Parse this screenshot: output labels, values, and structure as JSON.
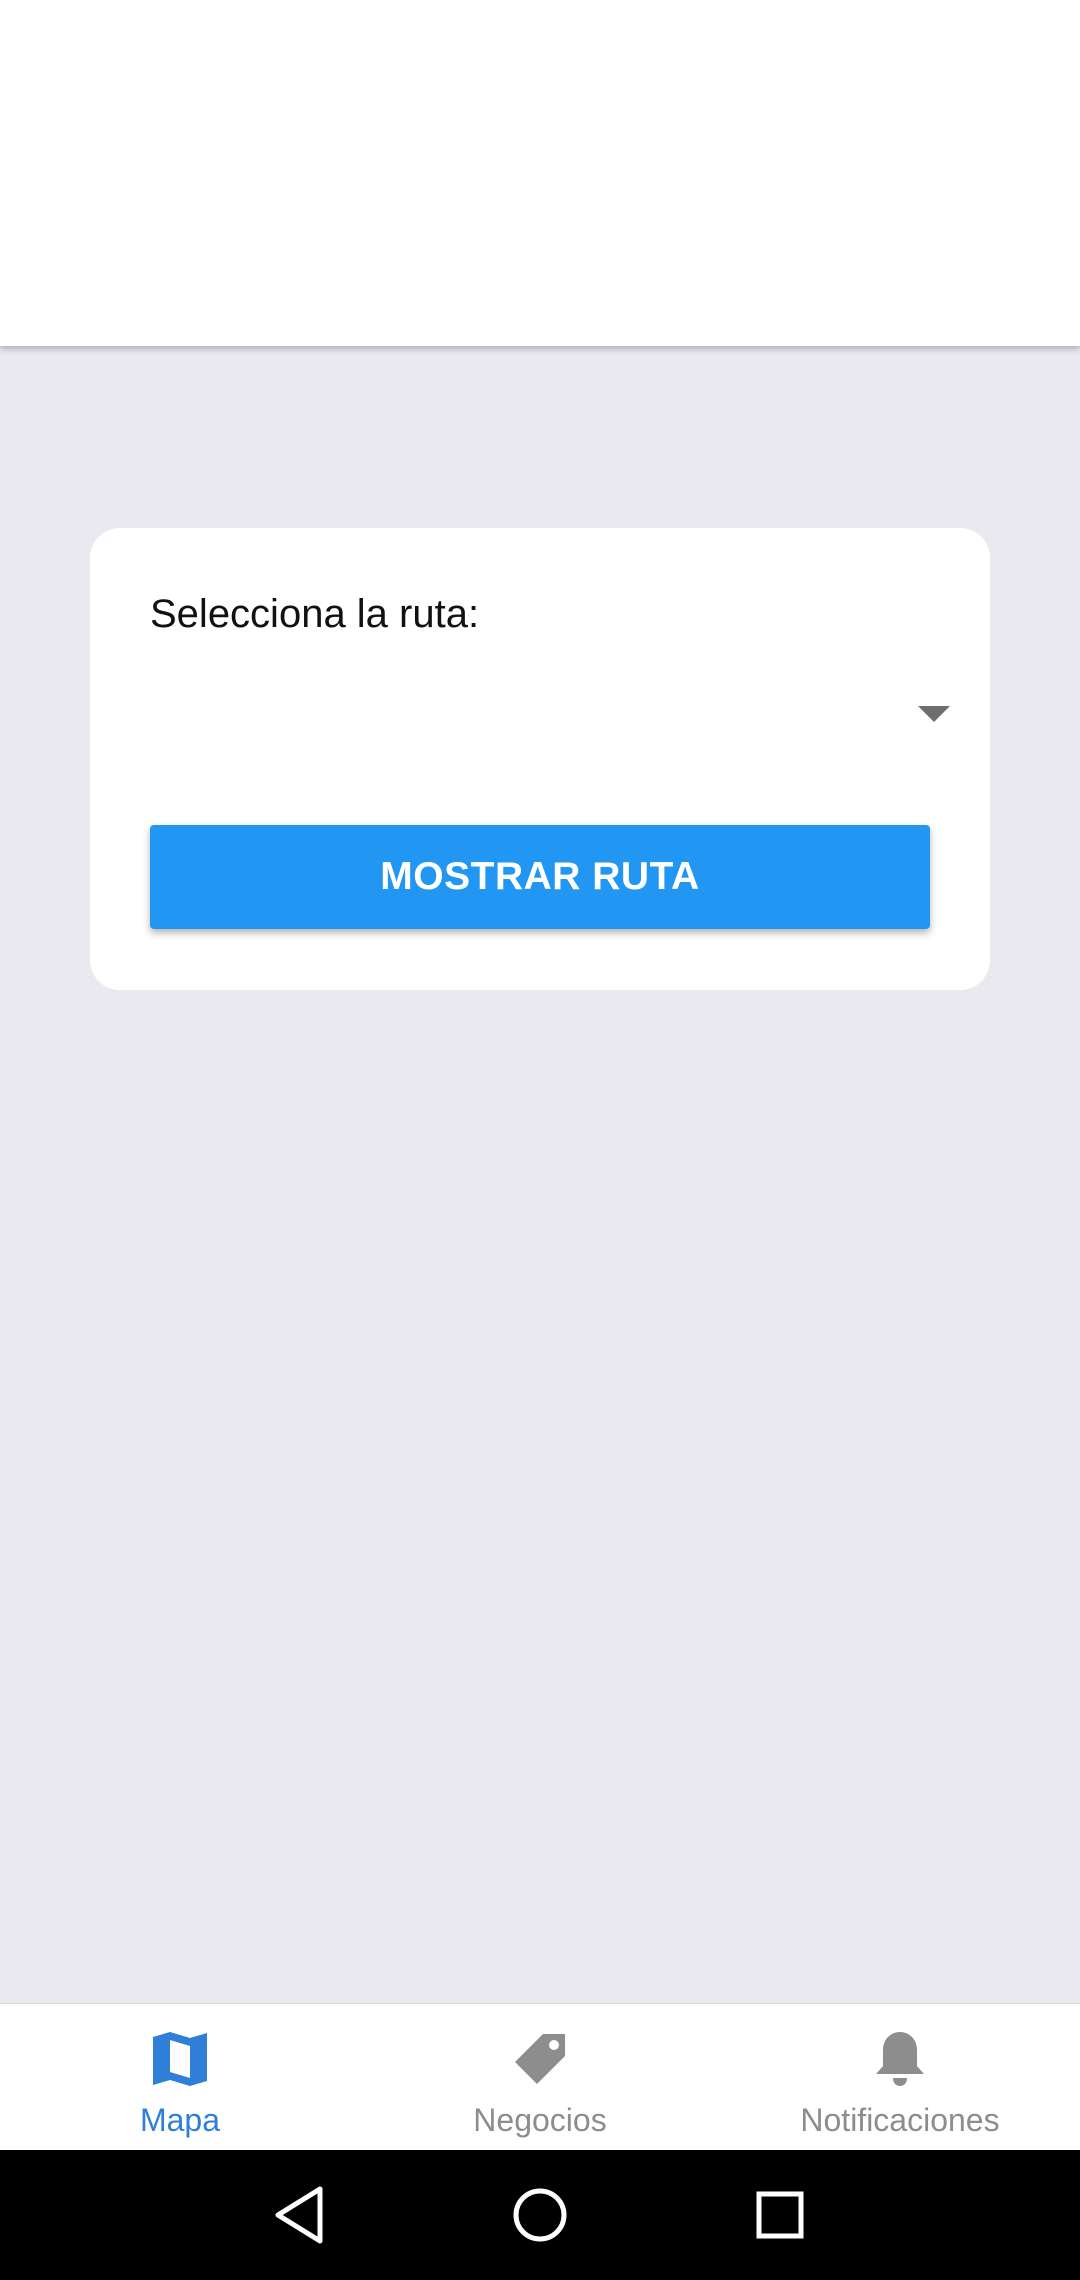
{
  "card": {
    "label": "Selecciona la ruta:",
    "picker_value": "",
    "button_label": "MOSTRAR RUTA"
  },
  "tabs": [
    {
      "label": "Mapa",
      "icon": "map-icon",
      "active": true
    },
    {
      "label": "Negocios",
      "icon": "tag-icon",
      "active": false
    },
    {
      "label": "Notificaciones",
      "icon": "bell-icon",
      "active": false
    }
  ],
  "navigation": {
    "buttons": [
      "back-icon",
      "home-icon",
      "recents-icon"
    ]
  },
  "colors": {
    "accent": "#2196f3",
    "active_tab": "#2f7fd9",
    "inactive_tab": "#8d8d8d",
    "background": "#e9e9ef"
  }
}
